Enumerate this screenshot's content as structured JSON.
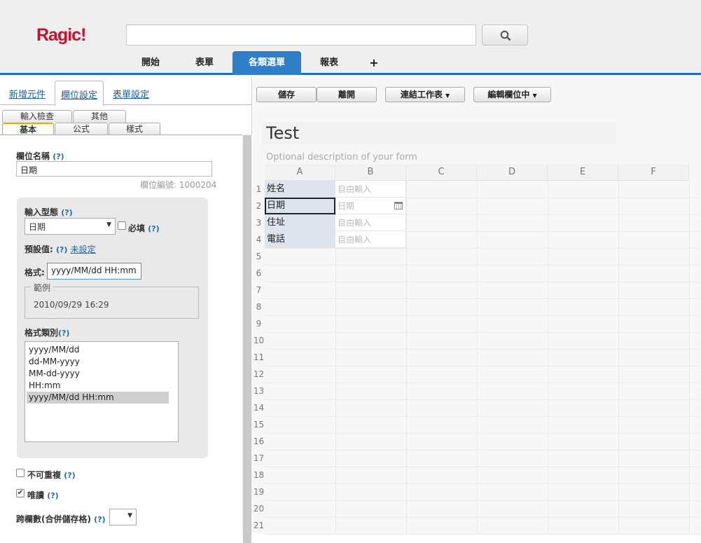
{
  "app": {
    "logo": "Ragic!"
  },
  "search": {
    "value": ""
  },
  "top_tabs": [
    "開始",
    "表單",
    "各類選單",
    "報表",
    "+"
  ],
  "left_tabs": [
    "新增元件",
    "欄位設定",
    "表單設定"
  ],
  "sub_tabs_row1": [
    "輸入檢查",
    "其他"
  ],
  "sub_tabs_row2": [
    "基本",
    "公式",
    "樣式"
  ],
  "field": {
    "name_label": "欄位名稱",
    "help": "(?)",
    "name_value": "日期",
    "field_id": "欄位編號: 1000204",
    "type_label": "輸入型態",
    "type_value": "日期",
    "required_label": "必填",
    "default_label": "預設值:",
    "default_value": "未設定",
    "format_label": "格式:",
    "format_value": "yyyy/MM/dd HH:mm",
    "example_legend": "範例",
    "example_value": "2010/09/29 16:29",
    "format_types_label": "格式類別",
    "format_types": [
      "yyyy/MM/dd",
      "dd-MM-yyyy",
      "MM-dd-yyyy",
      "HH:mm",
      "yyyy/MM/dd HH:mm"
    ],
    "unique_label": "不可重複",
    "readonly_label": "唯讀",
    "colspan_label": "跨欄數(合併儲存格)",
    "colspan_value": ""
  },
  "toolbar": {
    "save": "儲存",
    "leave": "離開",
    "link_sheet": "連結工作表",
    "editing": "編輯欄位中"
  },
  "form": {
    "title": "Test",
    "description": "Optional description of your form"
  },
  "sheet": {
    "columns": [
      "A",
      "B",
      "C",
      "D",
      "E",
      "F"
    ],
    "rows": [
      "1",
      "2",
      "3",
      "4",
      "5",
      "6",
      "7",
      "8",
      "9",
      "10",
      "11",
      "12",
      "13",
      "14",
      "15",
      "16",
      "17",
      "18",
      "19",
      "20",
      "21"
    ],
    "cells": [
      {
        "label": "姓名",
        "value": "自由輸入"
      },
      {
        "label": "日期",
        "value": "日期"
      },
      {
        "label": "住址",
        "value": "自由輸入"
      },
      {
        "label": "電話",
        "value": "自由輸入"
      }
    ]
  },
  "colors": {
    "accent": "#2f7fc8",
    "logo": "#c8102e",
    "label_cell": "#dde4ed"
  }
}
